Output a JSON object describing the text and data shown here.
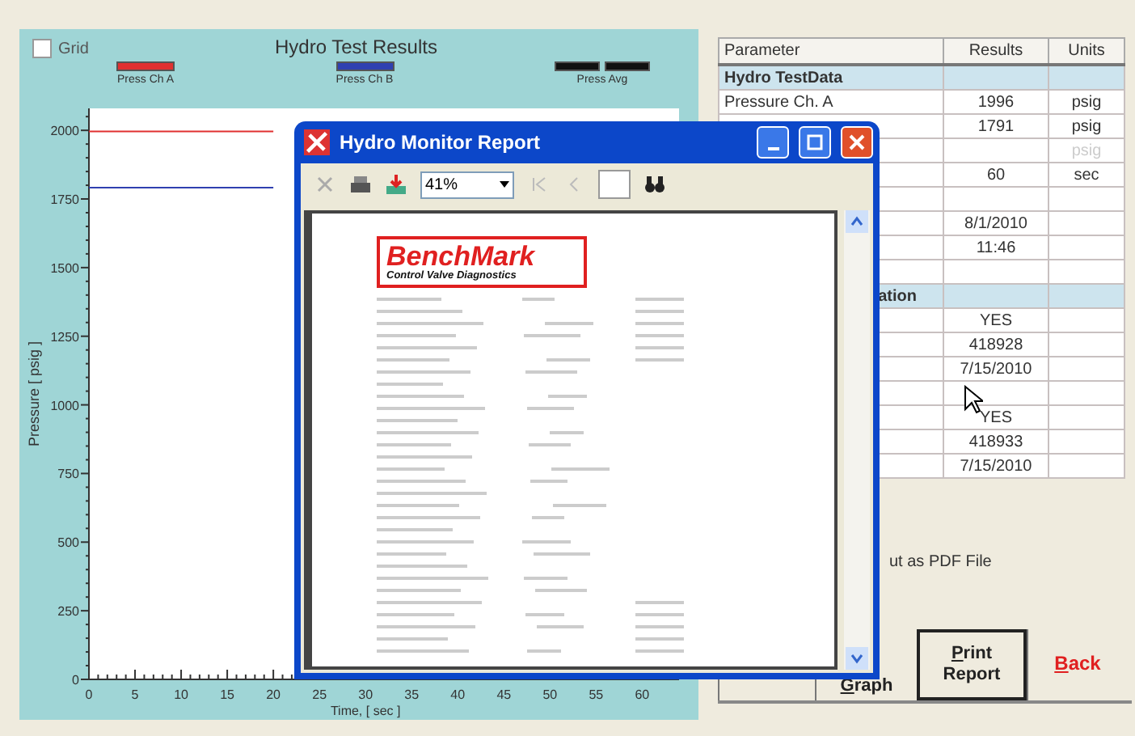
{
  "chart_panel": {
    "grid_checkbox": {
      "label": "Grid",
      "checked": false
    },
    "chart_data": {
      "type": "line",
      "title": "Hydro Test Results",
      "xlabel": "Time, [ sec ]",
      "ylabel": "Pressure [ psig ]",
      "x": [
        0,
        20
      ],
      "xlim": [
        0,
        64
      ],
      "ylim": [
        0,
        2080
      ],
      "xticks": [
        0,
        5,
        10,
        15,
        20,
        25,
        30,
        35,
        40,
        45,
        50,
        55,
        60
      ],
      "yticks": [
        0,
        250,
        500,
        750,
        1000,
        1250,
        1500,
        1750,
        2000
      ],
      "series": [
        {
          "name": "Press Ch A",
          "color": "#e03030",
          "values": [
            1996,
            1996
          ]
        },
        {
          "name": "Press Ch B",
          "color": "#3040b0",
          "values": [
            1791,
            1791
          ]
        },
        {
          "name": "Press Avg",
          "color": "#111111",
          "values": [
            null,
            null
          ]
        }
      ]
    }
  },
  "results_table": {
    "columns": [
      "Parameter",
      "Results",
      "Units"
    ],
    "rows": [
      {
        "kind": "section",
        "parameter": "Hydro TestData"
      },
      {
        "kind": "row",
        "parameter": "Pressure Ch. A",
        "result": "1996",
        "unit": "psig"
      },
      {
        "kind": "row",
        "result": "1791",
        "unit": "psig"
      },
      {
        "kind": "row",
        "unit": "psig",
        "disabled": true
      },
      {
        "kind": "row",
        "result": "60",
        "unit": "sec"
      },
      {
        "kind": "row"
      },
      {
        "kind": "row",
        "result": "8/1/2010"
      },
      {
        "kind": "row",
        "result": "11:46"
      },
      {
        "kind": "row"
      },
      {
        "kind": "section_cut",
        "parameter": "ation"
      },
      {
        "kind": "row",
        "result": "YES"
      },
      {
        "kind": "row",
        "result": "418928"
      },
      {
        "kind": "row",
        "result": "7/15/2010"
      },
      {
        "kind": "row"
      },
      {
        "kind": "row",
        "result": "YES"
      },
      {
        "kind": "row",
        "result": "418933"
      },
      {
        "kind": "row",
        "result": "7/15/2010"
      }
    ]
  },
  "pdf_option": "ut as PDF File",
  "buttons": [
    {
      "kind": "hidden"
    },
    {
      "kind": "normal",
      "label": "Graph"
    },
    {
      "kind": "default",
      "label": "Print\nReport"
    },
    {
      "kind": "danger",
      "label": "Back"
    }
  ],
  "report_window": {
    "title": "Hydro Monitor Report",
    "zoom": "41%",
    "page": {
      "logo": "BenchMark",
      "logo_tagline": "Control Valve Diagnostics"
    }
  }
}
